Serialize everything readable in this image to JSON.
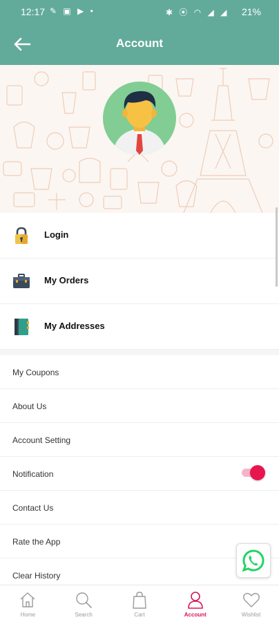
{
  "status_bar": {
    "time": "12:17",
    "left_icons": "✎ ▣ ▶ •",
    "right_icons": "✱ ⦿ ◠ ◢ ◢",
    "battery": "21%"
  },
  "header": {
    "title": "Account"
  },
  "menu": {
    "primary": [
      {
        "label": "Login",
        "icon": "lock-icon"
      },
      {
        "label": "My Orders",
        "icon": "briefcase-icon"
      },
      {
        "label": "My Addresses",
        "icon": "address-book-icon"
      }
    ],
    "secondary": [
      {
        "label": "My Coupons"
      },
      {
        "label": "About Us"
      },
      {
        "label": "Account Setting"
      },
      {
        "label": "Notification",
        "toggle_on": true
      },
      {
        "label": "Contact Us"
      },
      {
        "label": "Rate the App"
      },
      {
        "label": "Clear History"
      }
    ]
  },
  "bottom_nav": {
    "items": [
      {
        "label": "Home",
        "icon": "home-icon"
      },
      {
        "label": "Search",
        "icon": "search-icon"
      },
      {
        "label": "Cart",
        "icon": "shopping-bag-icon"
      },
      {
        "label": "Account",
        "icon": "user-icon",
        "active": true
      },
      {
        "label": "Wishlist",
        "icon": "heart-icon"
      }
    ]
  },
  "colors": {
    "header": "#62ab9b",
    "accent": "#e8164e",
    "active_nav": "#d8145a",
    "avatar_bg": "#81cd93"
  }
}
